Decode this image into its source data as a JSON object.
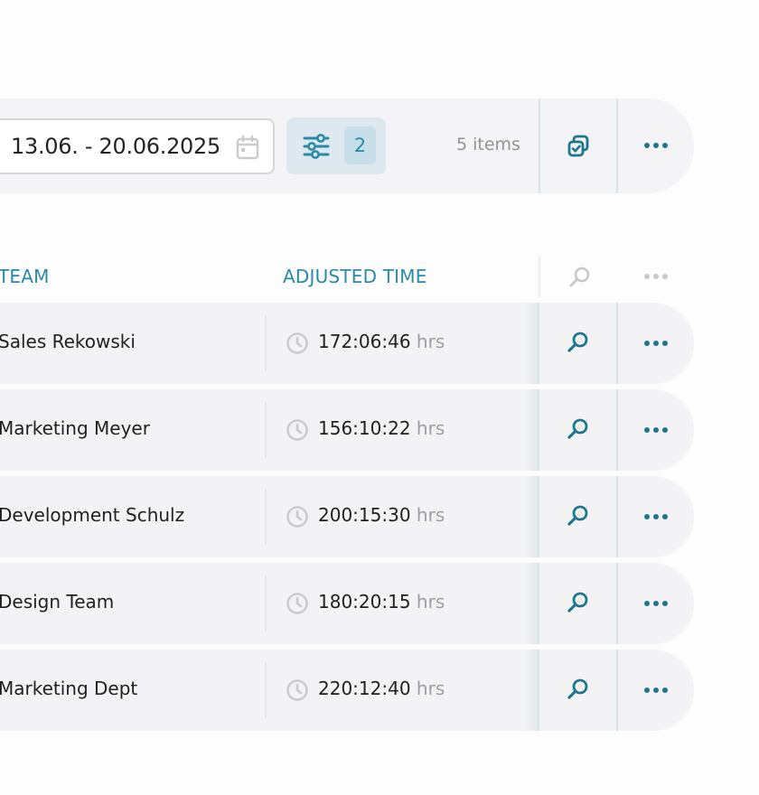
{
  "toolbar": {
    "date_range": "13.06. - 20.06.2025",
    "filter_count": "2",
    "items_count": "5 items",
    "icons": [
      "calendar-icon",
      "filter-sliders-icon",
      "copy-icon",
      "more-icon"
    ]
  },
  "table": {
    "headers": {
      "team": "TEAM",
      "adjusted_time": "ADJUSTED TIME"
    },
    "rows": [
      {
        "team": "Sales Rekowski",
        "time": "172:06:46",
        "unit": "hrs"
      },
      {
        "team": "Marketing Meyer",
        "time": "156:10:22",
        "unit": "hrs"
      },
      {
        "team": "Development Schulz",
        "time": "200:15:30",
        "unit": "hrs"
      },
      {
        "team": "Design Team",
        "time": "180:20:15",
        "unit": "hrs"
      },
      {
        "team": "Marketing Dept",
        "time": "220:12:40",
        "unit": "hrs"
      }
    ]
  },
  "colors": {
    "accent": "#2a8aa8",
    "accent_dark": "#1f7591",
    "muted_icon": "#c7c9cc",
    "row_bg": "#f3f3f5"
  }
}
